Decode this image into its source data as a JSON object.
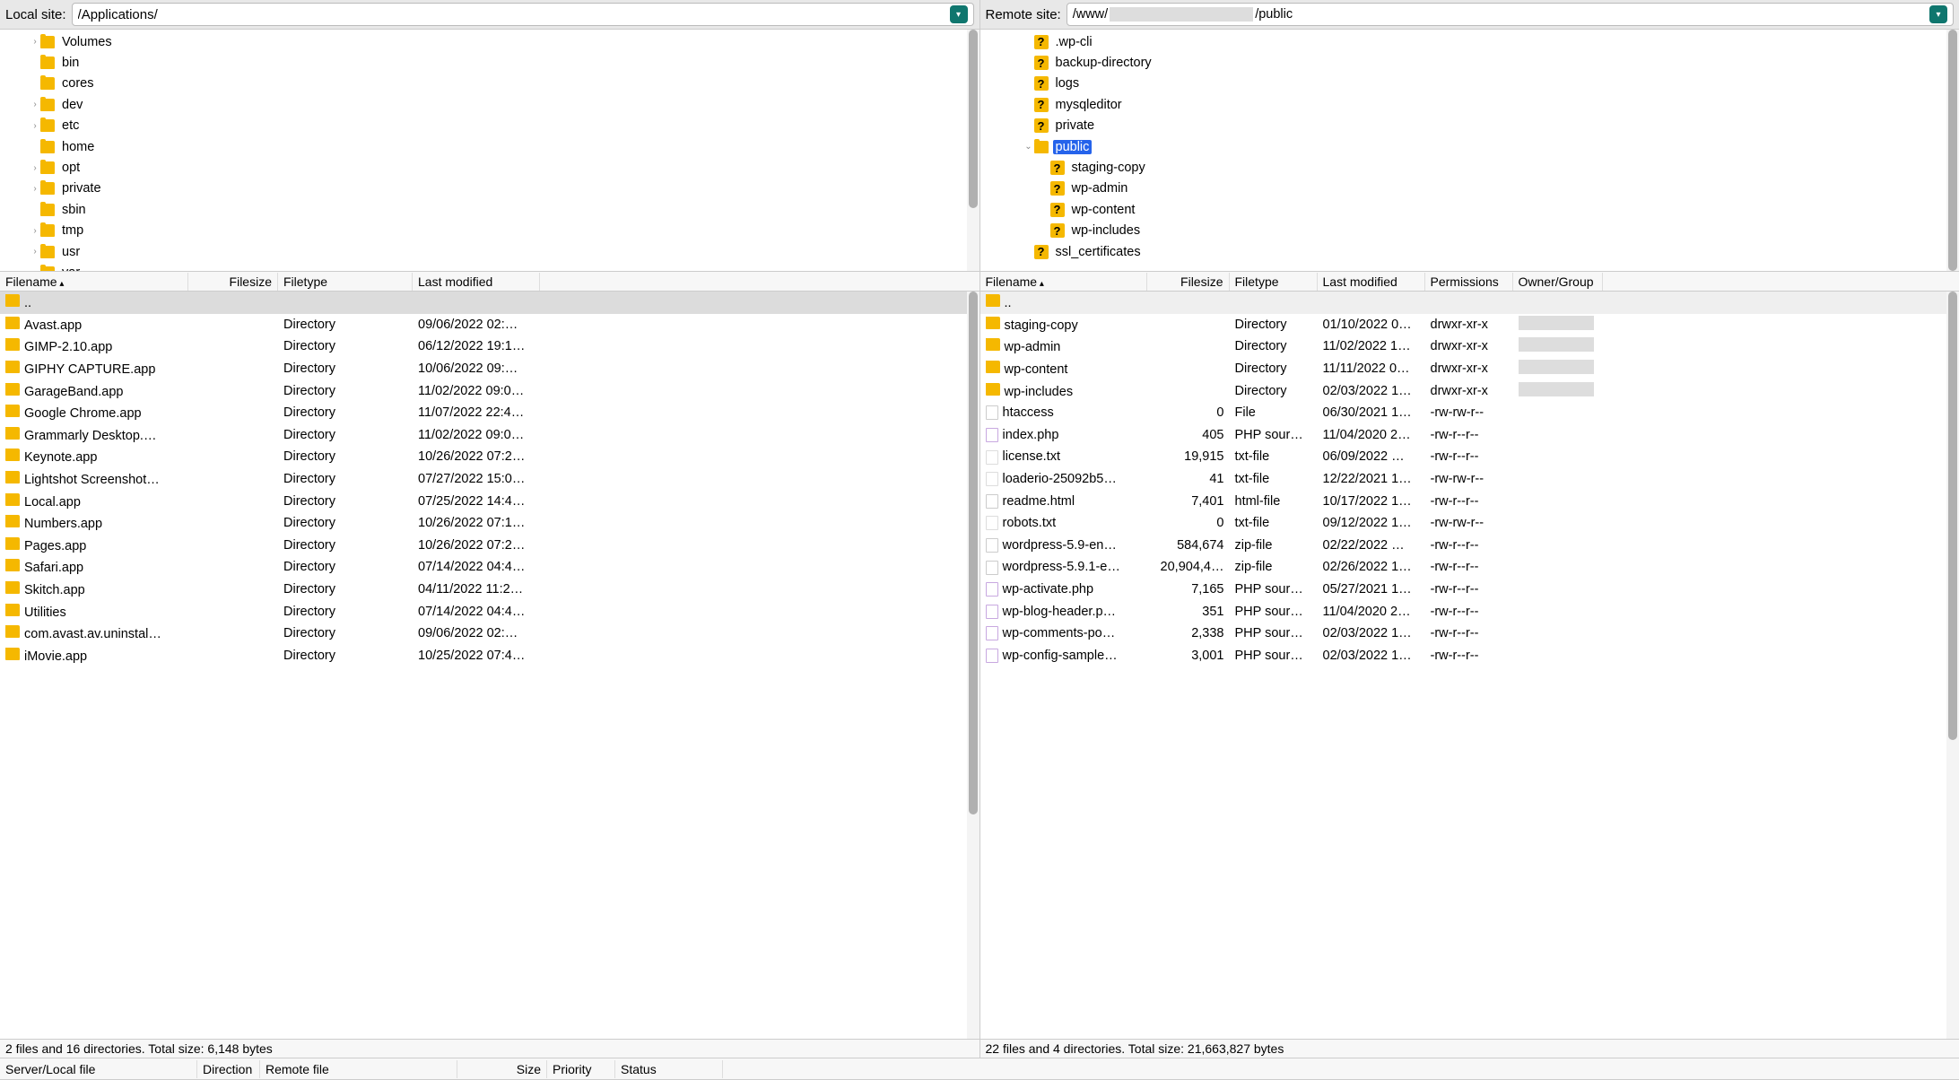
{
  "local": {
    "label": "Local site:",
    "path": "/Applications/",
    "tree": [
      {
        "indent": 45,
        "expand": "›",
        "icon": "folder",
        "label": "Volumes"
      },
      {
        "indent": 45,
        "expand": "",
        "icon": "folder",
        "label": "bin"
      },
      {
        "indent": 45,
        "expand": "",
        "icon": "folder",
        "label": "cores"
      },
      {
        "indent": 45,
        "expand": "›",
        "icon": "folder",
        "label": "dev"
      },
      {
        "indent": 45,
        "expand": "›",
        "icon": "folder",
        "label": "etc"
      },
      {
        "indent": 45,
        "expand": "",
        "icon": "folder",
        "label": "home"
      },
      {
        "indent": 45,
        "expand": "›",
        "icon": "folder",
        "label": "opt"
      },
      {
        "indent": 45,
        "expand": "›",
        "icon": "folder",
        "label": "private"
      },
      {
        "indent": 45,
        "expand": "",
        "icon": "folder",
        "label": "sbin"
      },
      {
        "indent": 45,
        "expand": "›",
        "icon": "folder",
        "label": "tmp"
      },
      {
        "indent": 45,
        "expand": "›",
        "icon": "folder",
        "label": "usr"
      },
      {
        "indent": 45,
        "expand": "",
        "icon": "folder",
        "label": "var"
      }
    ],
    "columns": {
      "filename": "Filename",
      "filesize": "Filesize",
      "filetype": "Filetype",
      "lastmod": "Last modified"
    },
    "files": [
      {
        "name": "..",
        "size": "",
        "type": "",
        "mod": "",
        "parent": true
      },
      {
        "name": "Avast.app",
        "size": "",
        "type": "Directory",
        "mod": "09/06/2022 02:…"
      },
      {
        "name": "GIMP-2.10.app",
        "size": "",
        "type": "Directory",
        "mod": "06/12/2022 19:1…"
      },
      {
        "name": "GIPHY CAPTURE.app",
        "size": "",
        "type": "Directory",
        "mod": "10/06/2022 09:…"
      },
      {
        "name": "GarageBand.app",
        "size": "",
        "type": "Directory",
        "mod": "11/02/2022 09:0…"
      },
      {
        "name": "Google Chrome.app",
        "size": "",
        "type": "Directory",
        "mod": "11/07/2022 22:4…"
      },
      {
        "name": "Grammarly Desktop.…",
        "size": "",
        "type": "Directory",
        "mod": "11/02/2022 09:0…"
      },
      {
        "name": "Keynote.app",
        "size": "",
        "type": "Directory",
        "mod": "10/26/2022 07:2…"
      },
      {
        "name": "Lightshot Screenshot…",
        "size": "",
        "type": "Directory",
        "mod": "07/27/2022 15:0…"
      },
      {
        "name": "Local.app",
        "size": "",
        "type": "Directory",
        "mod": "07/25/2022 14:4…"
      },
      {
        "name": "Numbers.app",
        "size": "",
        "type": "Directory",
        "mod": "10/26/2022 07:1…"
      },
      {
        "name": "Pages.app",
        "size": "",
        "type": "Directory",
        "mod": "10/26/2022 07:2…"
      },
      {
        "name": "Safari.app",
        "size": "",
        "type": "Directory",
        "mod": "07/14/2022 04:4…"
      },
      {
        "name": "Skitch.app",
        "size": "",
        "type": "Directory",
        "mod": "04/11/2022 11:2…"
      },
      {
        "name": "Utilities",
        "size": "",
        "type": "Directory",
        "mod": "07/14/2022 04:4…"
      },
      {
        "name": "com.avast.av.uninstal…",
        "size": "",
        "type": "Directory",
        "mod": "09/06/2022 02:…"
      },
      {
        "name": "iMovie.app",
        "size": "",
        "type": "Directory",
        "mod": "10/25/2022 07:4…"
      }
    ],
    "status": "2 files and 16 directories. Total size: 6,148 bytes"
  },
  "remote": {
    "label": "Remote site:",
    "path_prefix": "/www/",
    "path_suffix": "/public",
    "tree": [
      {
        "indent": 60,
        "expand": "",
        "icon": "unknown",
        "label": ".wp-cli"
      },
      {
        "indent": 60,
        "expand": "",
        "icon": "unknown",
        "label": "backup-directory"
      },
      {
        "indent": 60,
        "expand": "",
        "icon": "unknown",
        "label": "logs"
      },
      {
        "indent": 60,
        "expand": "",
        "icon": "unknown",
        "label": "mysqleditor"
      },
      {
        "indent": 60,
        "expand": "",
        "icon": "unknown",
        "label": "private"
      },
      {
        "indent": 60,
        "expand": "⌄",
        "icon": "folder",
        "label": "public",
        "selected": true
      },
      {
        "indent": 78,
        "expand": "",
        "icon": "unknown",
        "label": "staging-copy"
      },
      {
        "indent": 78,
        "expand": "",
        "icon": "unknown",
        "label": "wp-admin"
      },
      {
        "indent": 78,
        "expand": "",
        "icon": "unknown",
        "label": "wp-content"
      },
      {
        "indent": 78,
        "expand": "",
        "icon": "unknown",
        "label": "wp-includes"
      },
      {
        "indent": 60,
        "expand": "",
        "icon": "unknown",
        "label": "ssl_certificates"
      }
    ],
    "columns": {
      "filename": "Filename",
      "filesize": "Filesize",
      "filetype": "Filetype",
      "lastmod": "Last modified",
      "permissions": "Permissions",
      "owner": "Owner/Group"
    },
    "files": [
      {
        "name": "..",
        "size": "",
        "type": "",
        "mod": "",
        "perm": "",
        "own": "",
        "parent": true,
        "icon": "folder"
      },
      {
        "name": "staging-copy",
        "size": "",
        "type": "Directory",
        "mod": "01/10/2022 0…",
        "perm": "drwxr-xr-x",
        "own": "blur",
        "icon": "folder"
      },
      {
        "name": "wp-admin",
        "size": "",
        "type": "Directory",
        "mod": "11/02/2022 1…",
        "perm": "drwxr-xr-x",
        "own": "blur",
        "icon": "folder"
      },
      {
        "name": "wp-content",
        "size": "",
        "type": "Directory",
        "mod": "11/11/2022 0…",
        "perm": "drwxr-xr-x",
        "own": "blur",
        "icon": "folder"
      },
      {
        "name": "wp-includes",
        "size": "",
        "type": "Directory",
        "mod": "02/03/2022 1…",
        "perm": "drwxr-xr-x",
        "own": "blur",
        "icon": "folder"
      },
      {
        "name": "htaccess",
        "size": "0",
        "type": "File",
        "mod": "06/30/2021 1…",
        "perm": "-rw-rw-r--",
        "own": "",
        "icon": "file"
      },
      {
        "name": "index.php",
        "size": "405",
        "type": "PHP sour…",
        "mod": "11/04/2020 2…",
        "perm": "-rw-r--r--",
        "own": "",
        "icon": "php"
      },
      {
        "name": "license.txt",
        "size": "19,915",
        "type": "txt-file",
        "mod": "06/09/2022 …",
        "perm": "-rw-r--r--",
        "own": "",
        "icon": "txt"
      },
      {
        "name": "loaderio-25092b5…",
        "size": "41",
        "type": "txt-file",
        "mod": "12/22/2021 1…",
        "perm": "-rw-rw-r--",
        "own": "",
        "icon": "txt"
      },
      {
        "name": "readme.html",
        "size": "7,401",
        "type": "html-file",
        "mod": "10/17/2022 1…",
        "perm": "-rw-r--r--",
        "own": "",
        "icon": "file"
      },
      {
        "name": "robots.txt",
        "size": "0",
        "type": "txt-file",
        "mod": "09/12/2022 1…",
        "perm": "-rw-rw-r--",
        "own": "",
        "icon": "txt"
      },
      {
        "name": "wordpress-5.9-en…",
        "size": "584,674",
        "type": "zip-file",
        "mod": "02/22/2022 …",
        "perm": "-rw-r--r--",
        "own": "",
        "icon": "file"
      },
      {
        "name": "wordpress-5.9.1-e…",
        "size": "20,904,4…",
        "type": "zip-file",
        "mod": "02/26/2022 1…",
        "perm": "-rw-r--r--",
        "own": "",
        "icon": "file"
      },
      {
        "name": "wp-activate.php",
        "size": "7,165",
        "type": "PHP sour…",
        "mod": "05/27/2021 1…",
        "perm": "-rw-r--r--",
        "own": "",
        "icon": "php"
      },
      {
        "name": "wp-blog-header.p…",
        "size": "351",
        "type": "PHP sour…",
        "mod": "11/04/2020 2…",
        "perm": "-rw-r--r--",
        "own": "",
        "icon": "php"
      },
      {
        "name": "wp-comments-po…",
        "size": "2,338",
        "type": "PHP sour…",
        "mod": "02/03/2022 1…",
        "perm": "-rw-r--r--",
        "own": "",
        "icon": "php"
      },
      {
        "name": "wp-config-sample…",
        "size": "3,001",
        "type": "PHP sour…",
        "mod": "02/03/2022 1…",
        "perm": "-rw-r--r--",
        "own": "",
        "icon": "php"
      }
    ],
    "status": "22 files and 4 directories. Total size: 21,663,827 bytes"
  },
  "queue": {
    "columns": {
      "file": "Server/Local file",
      "dir": "Direction",
      "remote": "Remote file",
      "size": "Size",
      "prio": "Priority",
      "status": "Status"
    }
  }
}
